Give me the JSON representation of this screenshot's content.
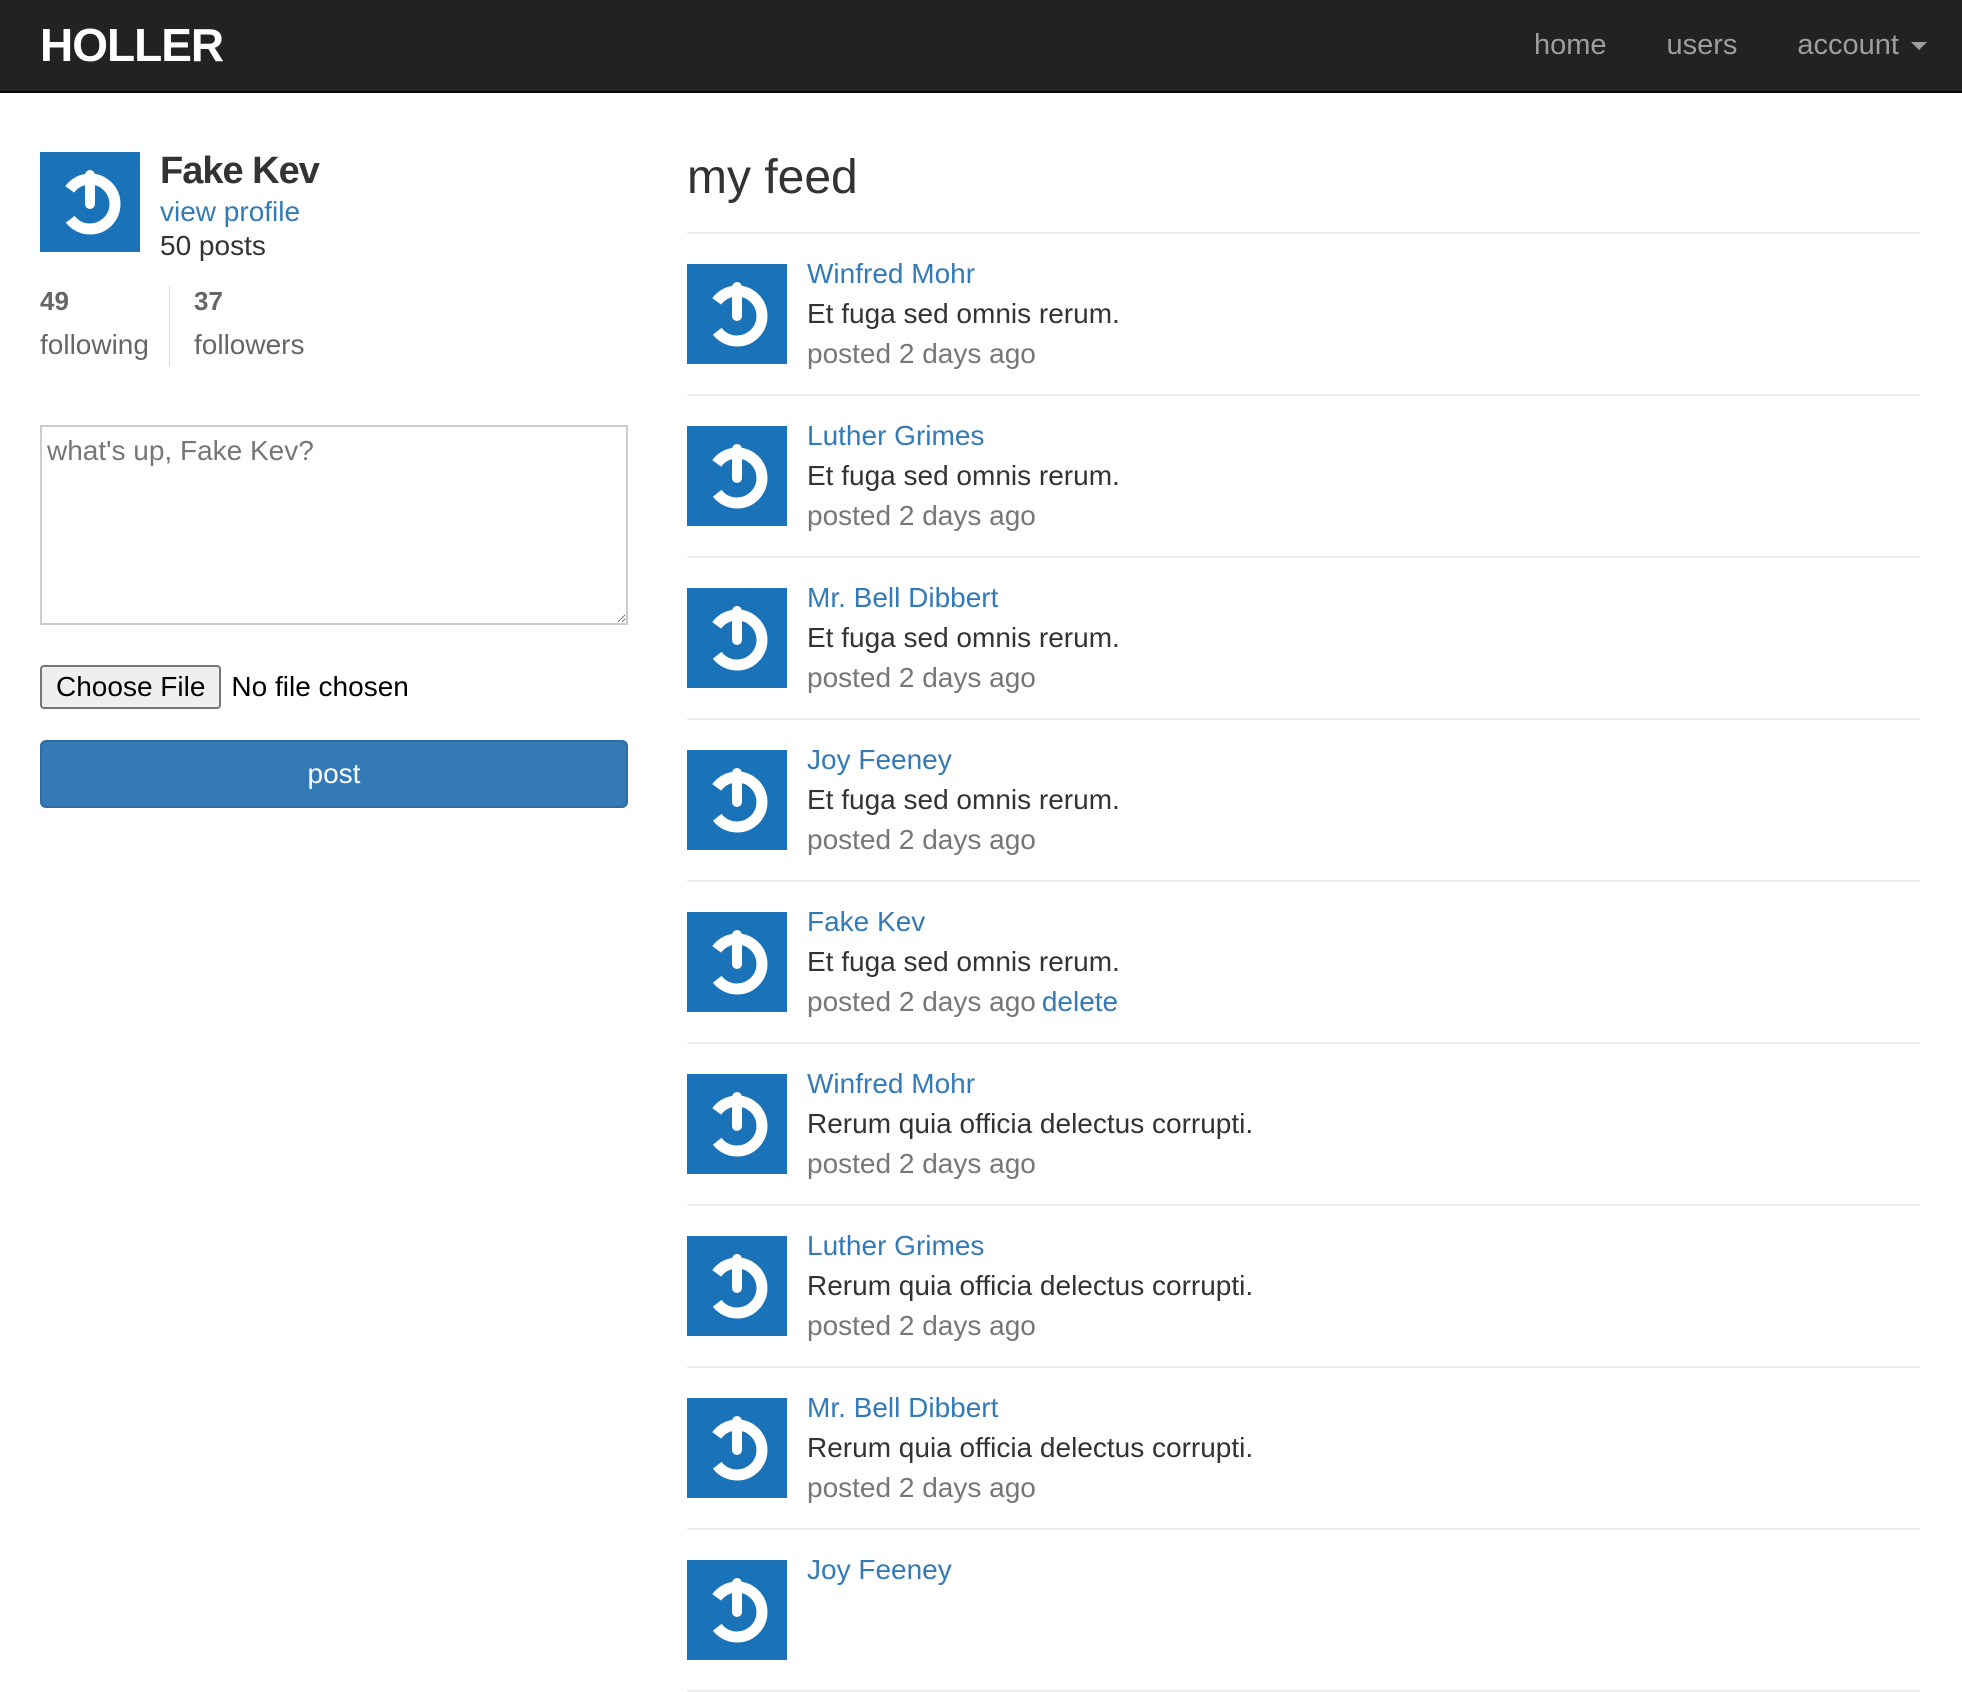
{
  "navbar": {
    "brand": "HOLLER",
    "links": {
      "home": "home",
      "users": "users",
      "account": "account"
    }
  },
  "user": {
    "name": "Fake Kev",
    "view_profile": "view profile",
    "posts": "50 posts",
    "following_count": "49",
    "following_label": "following",
    "followers_count": "37",
    "followers_label": "followers"
  },
  "compose": {
    "placeholder": "what's up, Fake Kev?",
    "file_button": "Choose File",
    "file_status": "No file chosen",
    "post_button": "post"
  },
  "feed": {
    "title": "my feed",
    "items": [
      {
        "author": "Winfred Mohr",
        "content": "Et fuga sed omnis rerum.",
        "meta": "posted 2 days ago"
      },
      {
        "author": "Luther Grimes",
        "content": "Et fuga sed omnis rerum.",
        "meta": "posted 2 days ago"
      },
      {
        "author": "Mr. Bell Dibbert",
        "content": "Et fuga sed omnis rerum.",
        "meta": "posted 2 days ago"
      },
      {
        "author": "Joy Feeney",
        "content": "Et fuga sed omnis rerum.",
        "meta": "posted 2 days ago"
      },
      {
        "author": "Fake Kev",
        "content": "Et fuga sed omnis rerum.",
        "meta": "posted 2 days ago",
        "delete": "delete"
      },
      {
        "author": "Winfred Mohr",
        "content": "Rerum quia officia delectus corrupti.",
        "meta": "posted 2 days ago"
      },
      {
        "author": "Luther Grimes",
        "content": "Rerum quia officia delectus corrupti.",
        "meta": "posted 2 days ago"
      },
      {
        "author": "Mr. Bell Dibbert",
        "content": "Rerum quia officia delectus corrupti.",
        "meta": "posted 2 days ago"
      },
      {
        "author": "Joy Feeney",
        "content": "",
        "meta": ""
      }
    ]
  },
  "colors": {
    "navbar_bg": "#222222",
    "link": "#337ab7",
    "avatar_bg": "#1a73b8"
  }
}
